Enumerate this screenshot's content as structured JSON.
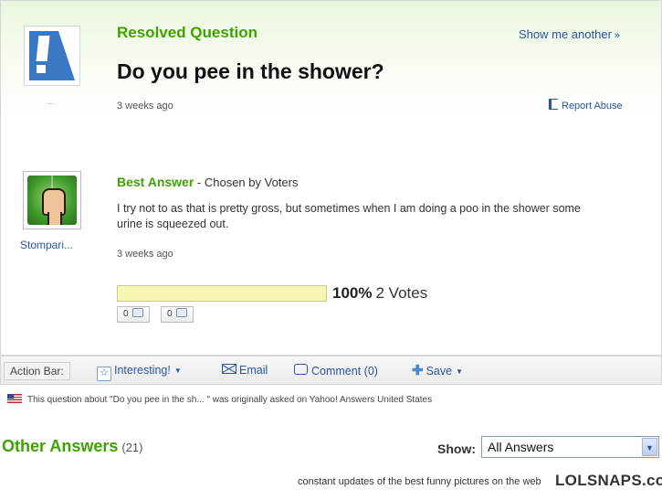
{
  "question": {
    "status_label": "Resolved Question",
    "show_another": "Show me another",
    "show_another_arrow": "»",
    "avatar_dots": "...",
    "title": "Do you pee in the shower?",
    "timestamp": "3 weeks ago",
    "report_label": "Report Abuse"
  },
  "best_answer": {
    "heading": "Best Answer",
    "chosen_by": " - Chosen by Voters",
    "username": "Stompari...",
    "text": "I try not to as that is pretty gross, but sometimes when I am doing a poo in the shower some urine is squeezed out.",
    "timestamp": "3 weeks ago",
    "vote_percent_label": "100%",
    "vote_percent_value": 100,
    "votes_label": "2 Votes",
    "thumbs_up_count": "0",
    "thumbs_down_count": "0"
  },
  "action_bar": {
    "label": "Action Bar:",
    "interesting": "Interesting!",
    "email": "Email",
    "comment": "Comment (0)",
    "save": "Save"
  },
  "origin_note": "This question about \"Do you pee in the sh... \" was originally asked on Yahoo! Answers United States",
  "other_answers": {
    "heading": "Other Answers",
    "count": "(21)",
    "show_label": "Show:",
    "selected_option": "All Answers"
  },
  "footer": {
    "tagline": "constant updates of the best funny pictures on the web",
    "brand": "LOLSNAPS.com"
  },
  "colors": {
    "accent_green": "#3fa200",
    "link_blue": "#2a55a0",
    "vote_bar": "#f6f6b4"
  }
}
